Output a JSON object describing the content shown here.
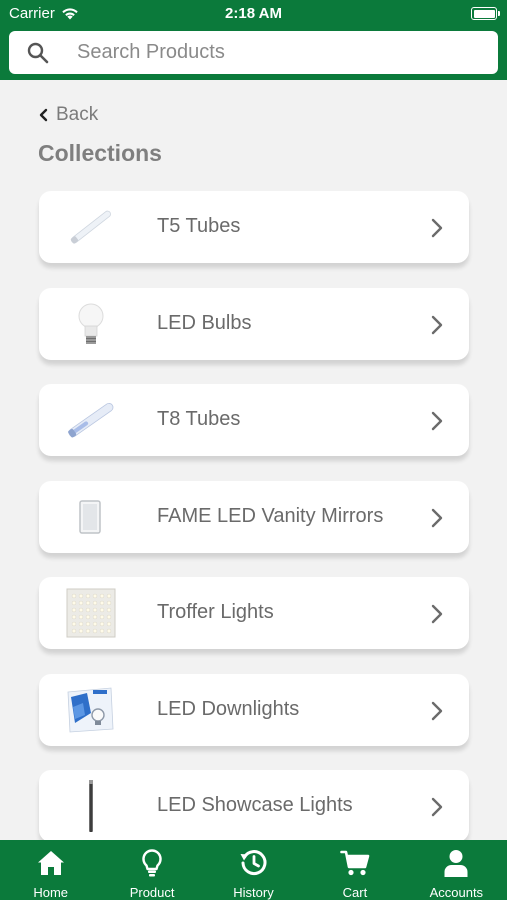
{
  "status": {
    "carrier": "Carrier",
    "time": "2:18 AM"
  },
  "search": {
    "placeholder": "Search Products",
    "value": ""
  },
  "nav": {
    "back_label": "Back"
  },
  "page": {
    "title": "Collections"
  },
  "collections": [
    {
      "label": "T5 Tubes",
      "thumb": "t5-tube-image"
    },
    {
      "label": "LED Bulbs",
      "thumb": "led-bulb-image"
    },
    {
      "label": "T8 Tubes",
      "thumb": "t8-tube-image"
    },
    {
      "label": "FAME LED Vanity Mirrors",
      "thumb": "vanity-mirror-image"
    },
    {
      "label": "Troffer Lights",
      "thumb": "troffer-light-image"
    },
    {
      "label": "LED Downlights",
      "thumb": "downlight-image"
    },
    {
      "label": "LED Showcase Lights",
      "thumb": "showcase-light-image"
    }
  ],
  "tabbar": {
    "items": [
      {
        "label": "Home",
        "icon": "home-icon"
      },
      {
        "label": "Product",
        "icon": "lightbulb-icon"
      },
      {
        "label": "History",
        "icon": "history-icon"
      },
      {
        "label": "Cart",
        "icon": "cart-icon"
      },
      {
        "label": "Accounts",
        "icon": "account-icon"
      }
    ]
  },
  "colors": {
    "brand_green": "#0b7a3b",
    "background": "#f2f2f2",
    "text_gray": "#6a6a6a"
  }
}
